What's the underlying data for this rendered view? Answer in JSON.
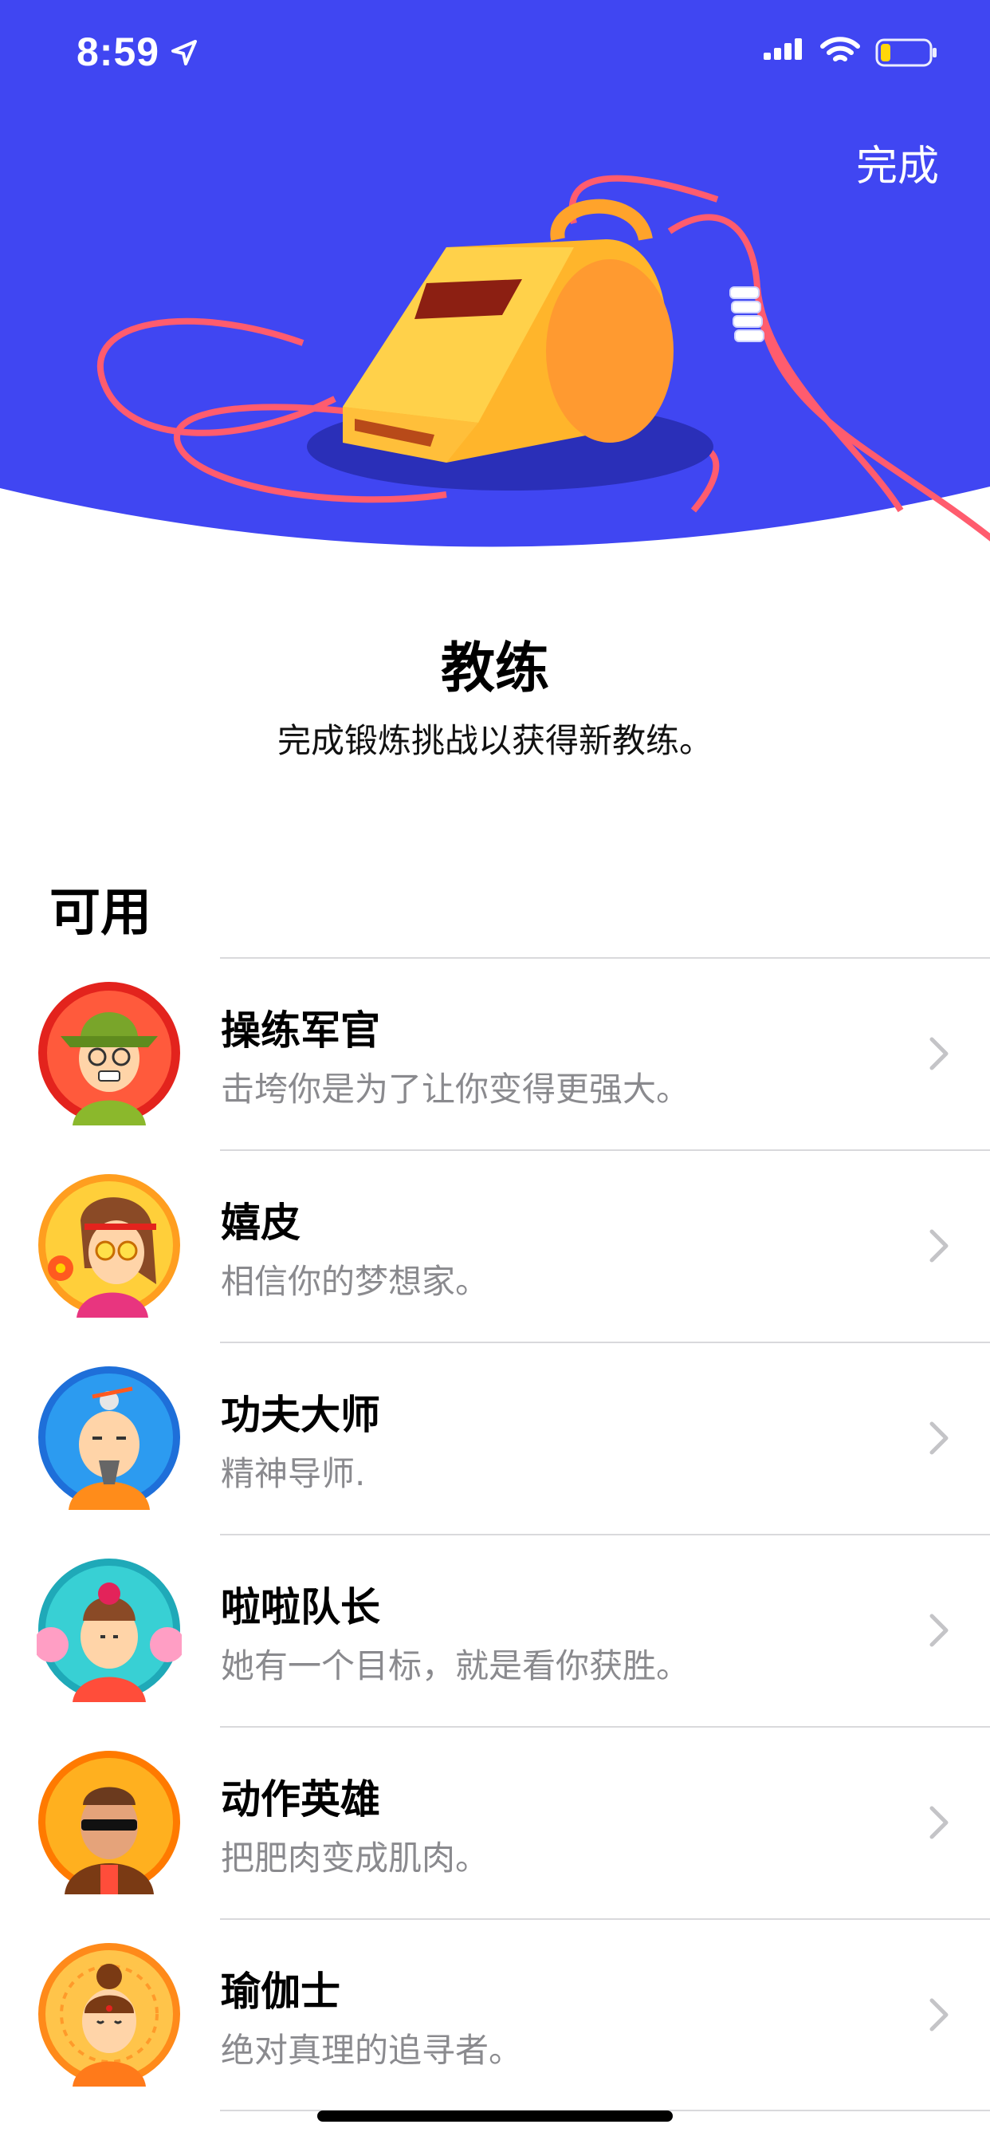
{
  "status_bar": {
    "time": "8:59"
  },
  "header": {
    "done_label": "完成",
    "background_color": "#4046f2"
  },
  "intro": {
    "title": "教练",
    "subtitle": "完成锻炼挑战以获得新教练。"
  },
  "section": {
    "title": "可用"
  },
  "coaches": [
    {
      "name": "操练军官",
      "description": "击垮你是为了让你变得更强大。",
      "avatar_icon": "drill-sergeant-avatar"
    },
    {
      "name": "嬉皮",
      "description": "相信你的梦想家。",
      "avatar_icon": "hippie-avatar"
    },
    {
      "name": "功夫大师",
      "description": "精神导师.",
      "avatar_icon": "kungfu-master-avatar"
    },
    {
      "name": "啦啦队长",
      "description": "她有一个目标，就是看你获胜。",
      "avatar_icon": "cheerleader-avatar"
    },
    {
      "name": "动作英雄",
      "description": "把肥肉变成肌肉。",
      "avatar_icon": "action-hero-avatar"
    },
    {
      "name": "瑜伽士",
      "description": "绝对真理的追寻者。",
      "avatar_icon": "yogi-avatar"
    }
  ]
}
